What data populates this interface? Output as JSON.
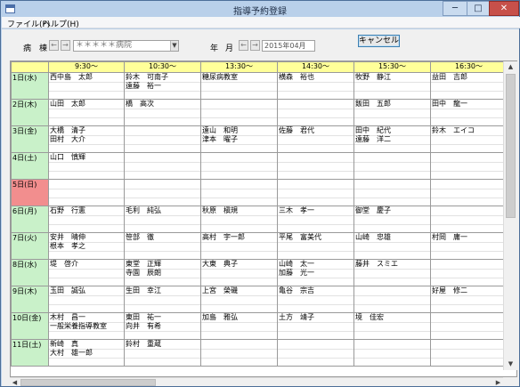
{
  "window": {
    "title": "指導予約登録",
    "min": "─",
    "max": "□",
    "close": "✕"
  },
  "menu": {
    "file": "ファイル(F)",
    "help": "ヘルプ(H)"
  },
  "toolbar": {
    "ward_label": "病　棟",
    "ward_value": "＊＊＊＊＊病院",
    "year_label": "年",
    "month_label": "月",
    "date_value": "2015年04月",
    "cancel_label": "キャンセル",
    "prev": "←",
    "next": "→"
  },
  "schedule": {
    "times": [
      "9:30～",
      "10:30～",
      "13:30～",
      "14:30～",
      "15:30～",
      "16:30～"
    ],
    "rows": [
      {
        "day": "1日(水)",
        "slots": [
          [
            "西中島　太郎",
            ""
          ],
          [
            "鈴木　可南子",
            "遠藤　裕一"
          ],
          [
            "糖尿病教室",
            ""
          ],
          [
            "横森　裕也",
            ""
          ],
          [
            "牧野　静江",
            ""
          ],
          [
            "益田　吉郎",
            ""
          ]
        ]
      },
      {
        "day": "2日(木)",
        "slots": [
          [
            "山田　太郎",
            ""
          ],
          [
            "橋　高次",
            ""
          ],
          [
            "",
            ""
          ],
          [
            "",
            ""
          ],
          [
            "飯田　五郎",
            ""
          ],
          [
            "田中　龍一",
            ""
          ]
        ]
      },
      {
        "day": "3日(金)",
        "slots": [
          [
            "大橋　清子",
            "田村　大介"
          ],
          [
            "",
            ""
          ],
          [
            "遠山　和明",
            "津本　曜子"
          ],
          [
            "佐藤　君代",
            ""
          ],
          [
            "田中　紀代",
            "遠藤　洋二"
          ],
          [
            "鈴木　エイコ",
            ""
          ]
        ]
      },
      {
        "day": "4日(土)",
        "slots": [
          [
            "山口　慎輝",
            ""
          ],
          [
            "",
            ""
          ],
          [
            "",
            ""
          ],
          [
            "",
            ""
          ],
          [
            "",
            ""
          ],
          [
            "",
            ""
          ]
        ]
      },
      {
        "day": "5日(日)",
        "slots": [
          [
            "",
            ""
          ],
          [
            "",
            ""
          ],
          [
            "",
            ""
          ],
          [
            "",
            ""
          ],
          [
            "",
            ""
          ],
          [
            "",
            ""
          ]
        ]
      },
      {
        "day": "6日(月)",
        "slots": [
          [
            "石野　行憲",
            ""
          ],
          [
            "毛利　純弘",
            ""
          ],
          [
            "秋原　槇規",
            ""
          ],
          [
            "三木　孝一",
            ""
          ],
          [
            "御堂　慶子",
            ""
          ],
          [
            "",
            ""
          ]
        ]
      },
      {
        "day": "7日(火)",
        "slots": [
          [
            "安井　晴伸",
            "根本　孝之"
          ],
          [
            "笹部　徹",
            ""
          ],
          [
            "高村　宇一郎",
            ""
          ],
          [
            "平尾　富美代",
            ""
          ],
          [
            "山崎　忠雄",
            ""
          ],
          [
            "村岡　庸一",
            ""
          ]
        ]
      },
      {
        "day": "8日(水)",
        "slots": [
          [
            "堤　啓介",
            ""
          ],
          [
            "東堂　正輝",
            "寺園　辰朗"
          ],
          [
            "大東　典子",
            ""
          ],
          [
            "山崎　太一",
            "加藤　光一"
          ],
          [
            "藤井　スミエ",
            ""
          ],
          [
            "",
            ""
          ]
        ]
      },
      {
        "day": "9日(木)",
        "slots": [
          [
            "玉田　誠弘",
            ""
          ],
          [
            "生田　幸江",
            ""
          ],
          [
            "上宮　榮磯",
            ""
          ],
          [
            "亀谷　宗吉",
            ""
          ],
          [
            "",
            ""
          ],
          [
            "好屋　修二",
            ""
          ]
        ]
      },
      {
        "day": "10日(金)",
        "slots": [
          [
            "木村　昌一",
            "一般栄養指導教室"
          ],
          [
            "東田　祐一",
            "向井　有希"
          ],
          [
            "加島　雅弘",
            ""
          ],
          [
            "土方　靖子",
            ""
          ],
          [
            "境　佳宏",
            ""
          ],
          [
            "",
            ""
          ]
        ]
      },
      {
        "day": "11日(土)",
        "slots": [
          [
            "新崎　真",
            "大村　雄一郎"
          ],
          [
            "鈴村　重蔵",
            ""
          ],
          [
            "",
            ""
          ],
          [
            "",
            ""
          ],
          [
            "",
            ""
          ],
          [
            "",
            ""
          ]
        ]
      }
    ]
  }
}
